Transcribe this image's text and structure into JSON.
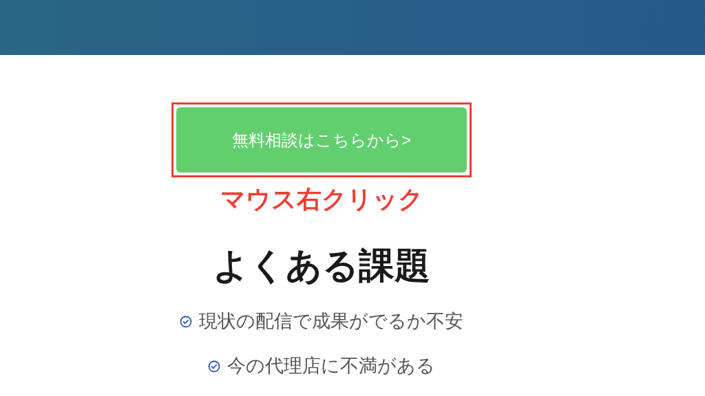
{
  "button": {
    "label": "無料相談はこちらから>"
  },
  "annotation": "マウス右クリック",
  "heading": "よくある課題",
  "issues": [
    "現状の配信で成果がでるか不安",
    "今の代理店に不満がある"
  ]
}
